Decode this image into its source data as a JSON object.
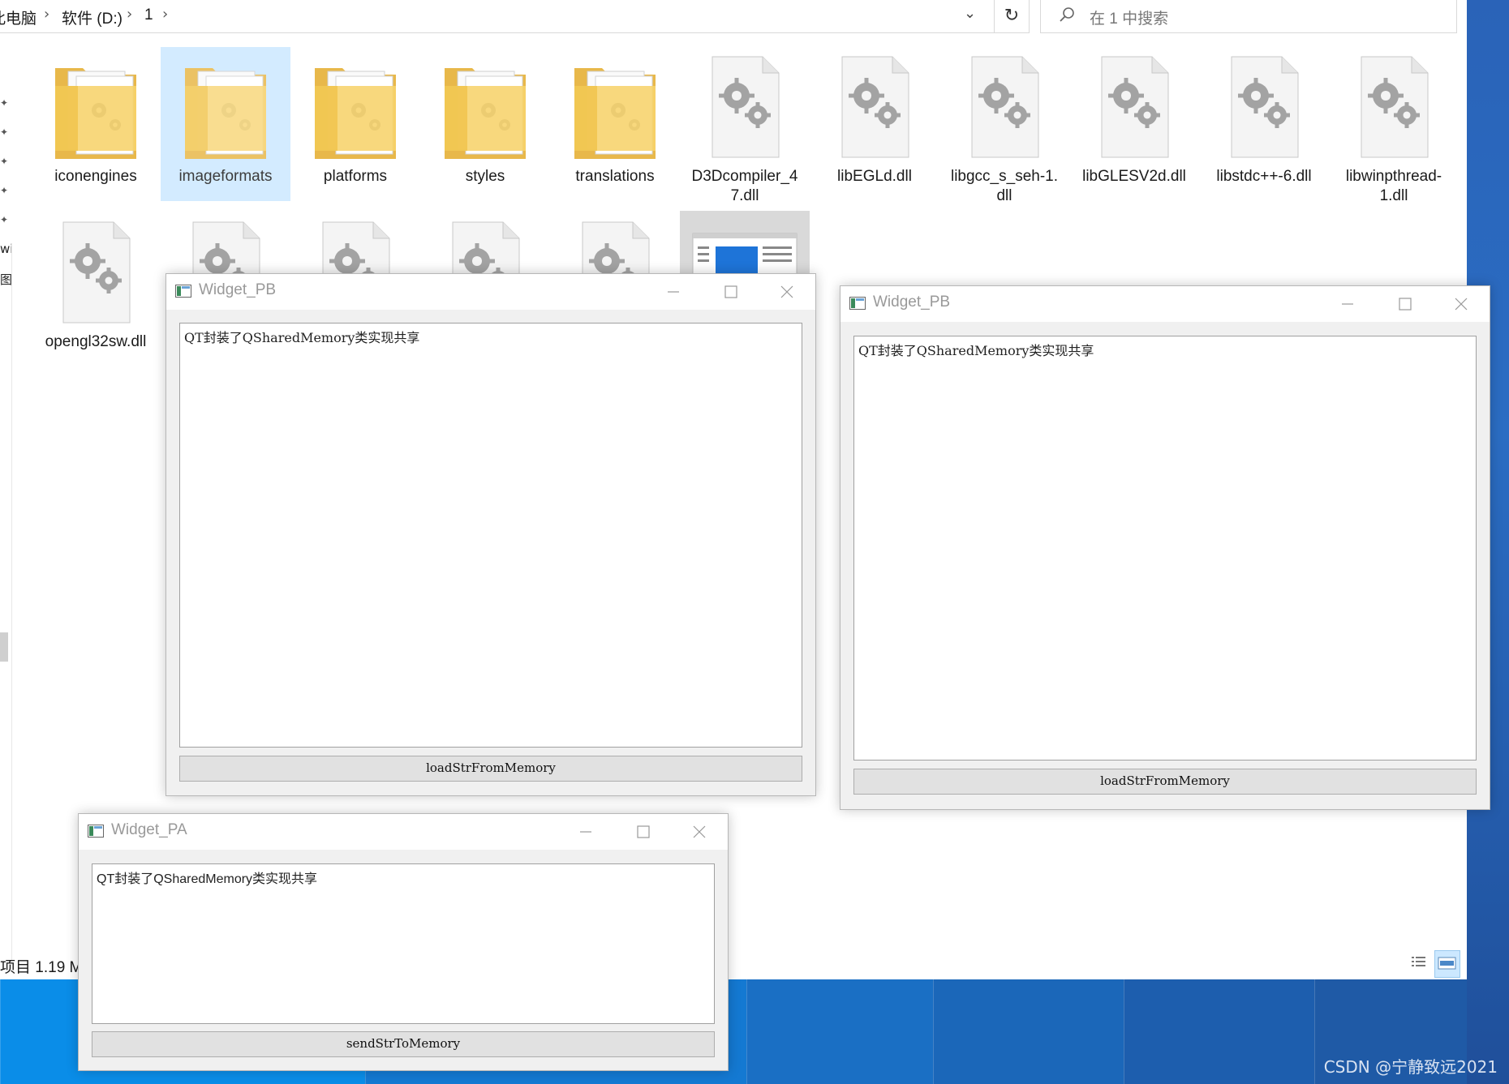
{
  "explorer": {
    "breadcrumb": [
      "此电脑",
      "软件 (D:)",
      "1"
    ],
    "search_placeholder": "在 1 中搜索",
    "items": [
      {
        "label": "iconengines",
        "type": "folder",
        "selected": false
      },
      {
        "label": "imageformats",
        "type": "folder",
        "selected": true
      },
      {
        "label": "platforms",
        "type": "folder",
        "selected": false
      },
      {
        "label": "styles",
        "type": "folder",
        "selected": false
      },
      {
        "label": "translations",
        "type": "folder",
        "selected": false
      },
      {
        "label": "D3Dcompiler_47.dll",
        "label_lines": [
          "D3Dcompiler_4",
          "7.dll"
        ],
        "type": "dll"
      },
      {
        "label": "libEGLd.dll",
        "type": "dll"
      },
      {
        "label": "libgcc_s_seh-1.dll",
        "label_lines": [
          "libgcc_s_seh-1.",
          "dll"
        ],
        "type": "dll"
      },
      {
        "label": "libGLESV2d.dll",
        "type": "dll"
      },
      {
        "label": "libstdc++-6.dll",
        "type": "dll"
      },
      {
        "label": "libwinpthread-1.dll",
        "label_lines": [
          "libwinpthread-",
          "1.dll"
        ],
        "type": "dll"
      },
      {
        "label": "opengl32sw.dll",
        "type": "dll"
      }
    ],
    "status_text": "项目  1.19 M",
    "left_nav_fragments": [
      "wi",
      "图"
    ]
  },
  "windows": [
    {
      "id": "pb-1",
      "title": "Widget_PB",
      "text": "QT封装了QSharedMemory类实现共享",
      "button_label": "loadStrFromMemory"
    },
    {
      "id": "pb-2",
      "title": "Widget_PB",
      "text": "QT封装了QSharedMemory类实现共享",
      "button_label": "loadStrFromMemory"
    },
    {
      "id": "pa",
      "title": "Widget_PA",
      "text": "QT封装了QSharedMemory类实现共享",
      "button_label": "sendStrToMemory"
    }
  ],
  "watermark": "CSDN @宁静致远2021",
  "colors": {
    "selection": "#cce8ff",
    "desktop": "#1a74c9",
    "folder": "#f7d36b",
    "gear": "#9a9a9a"
  }
}
